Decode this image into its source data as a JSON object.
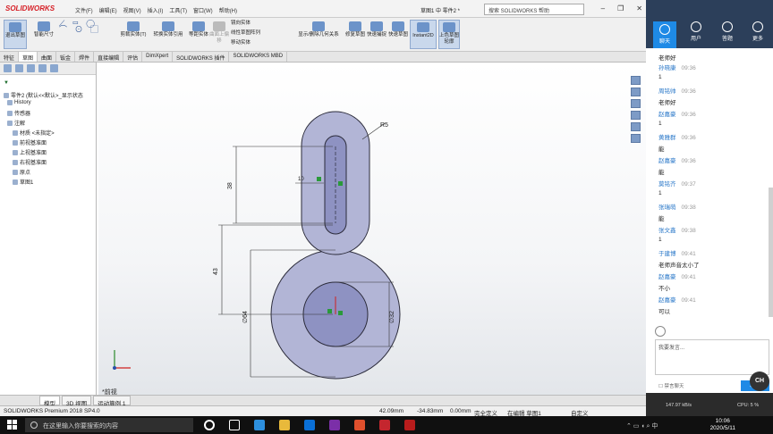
{
  "app": {
    "logo": "SOLIDWORKS",
    "menus": [
      "文件(F)",
      "编辑(E)",
      "视图(V)",
      "插入(I)",
      "工具(T)",
      "窗口(W)",
      "帮助(H)"
    ],
    "doc_title": "草图1 中 零件2 *",
    "search_placeholder": "搜索 SOLIDWORKS 帮助"
  },
  "ribbon": {
    "buttons": [
      "退出草图",
      "智能尺寸",
      "剪裁实体(T)",
      "转换实体引用",
      "等距实体",
      "曲面上偏移",
      "镜向实体",
      "线性草图阵列",
      "移动实体",
      "显示/删除几何关系",
      "修复草图",
      "快速捕捉",
      "快速草图",
      "Instant2D",
      "上色草图轮廓"
    ]
  },
  "tabs": [
    "特征",
    "草图",
    "曲面",
    "钣金",
    "焊件",
    "直接编辑",
    "评估",
    "DimXpert",
    "SOLIDWORKS 插件",
    "SOLIDWORKS MBD"
  ],
  "tree": {
    "root": "零件2 (默认<<默认>_显示状态",
    "items": [
      "History",
      "传感器",
      "注解",
      "材质 <未指定>",
      "前视基准面",
      "上视基准面",
      "右视基准面",
      "原点",
      "草图1"
    ]
  },
  "drawing": {
    "dims": [
      "R5",
      "38",
      "10",
      "43",
      "∅64",
      "∅32"
    ],
    "view_label": "*前视"
  },
  "bottom_tabs": [
    "模型",
    "3D 视图",
    "运动算例 1"
  ],
  "status": {
    "product": "SOLIDWORKS Premium 2018 SP4.0",
    "x": "42.09mm",
    "y": "-34.83mm",
    "z": "0.00mm",
    "state": "完全定义",
    "editing": "在编辑 草图1",
    "custom": "自定义"
  },
  "chat": {
    "tabs": [
      "聊天",
      "用户",
      "答题",
      "更多"
    ],
    "messages": [
      {
        "who": "",
        "time": "",
        "text": "老师好"
      },
      {
        "who": "孙晓康",
        "time": "09:36",
        "text": "1"
      },
      {
        "who": "周铭帅",
        "time": "09:36",
        "text": "老师好"
      },
      {
        "who": "赵嘉豪",
        "time": "09:36",
        "text": "1"
      },
      {
        "who": "黄雅群",
        "time": "09:36",
        "text": "能"
      },
      {
        "who": "赵嘉豪",
        "time": "09:36",
        "text": "能"
      },
      {
        "who": "莫铭齐",
        "time": "09:37",
        "text": "1"
      },
      {
        "who": "张瑞萌",
        "time": "09:38",
        "text": "能"
      },
      {
        "who": "张文鑫",
        "time": "09:38",
        "text": "1"
      },
      {
        "who": "于建博",
        "time": "09:41",
        "text": "老师声音太小了"
      },
      {
        "who": "赵嘉豪",
        "time": "09:41",
        "text": "不小"
      },
      {
        "who": "赵嘉豪",
        "time": "09:41",
        "text": "可以"
      }
    ],
    "input_placeholder": "我要发言...",
    "mute_label": "禁言聊天",
    "send": "发送",
    "speed": "147.97 kB/s",
    "cpu": "CPU: 5 %",
    "badge": "CH"
  },
  "taskbar": {
    "search": "在这里输入你要搜索的内容",
    "time": "10:06",
    "date": "2020/5/11"
  }
}
